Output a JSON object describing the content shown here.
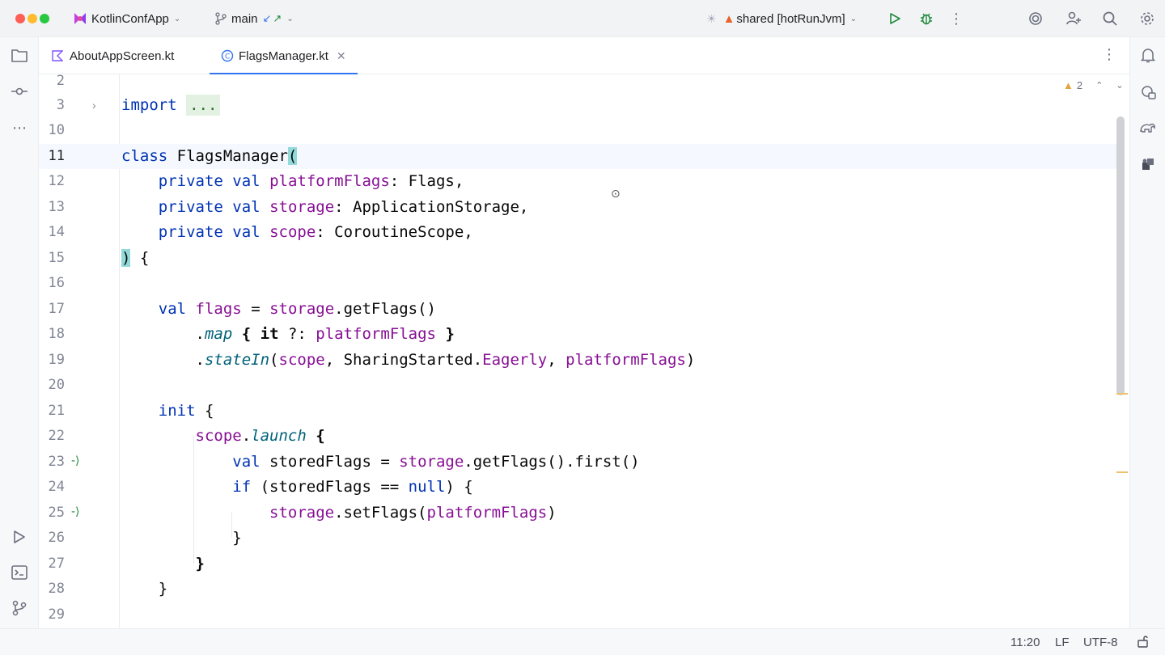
{
  "titlebar": {
    "project": "KotlinConfApp",
    "branch": "main",
    "run_config": "shared [hotRunJvm]"
  },
  "tabs": [
    {
      "label": "AboutAppScreen.kt",
      "active": false
    },
    {
      "label": "FlagsManager.kt",
      "active": true
    }
  ],
  "editor": {
    "warnings_count": "2",
    "lines": [
      {
        "num": "2"
      },
      {
        "num": "3"
      },
      {
        "num": "10"
      },
      {
        "num": "11"
      },
      {
        "num": "12"
      },
      {
        "num": "13"
      },
      {
        "num": "14"
      },
      {
        "num": "15"
      },
      {
        "num": "16"
      },
      {
        "num": "17"
      },
      {
        "num": "18"
      },
      {
        "num": "19"
      },
      {
        "num": "20"
      },
      {
        "num": "21"
      },
      {
        "num": "22"
      },
      {
        "num": "23"
      },
      {
        "num": "24"
      },
      {
        "num": "25"
      },
      {
        "num": "26"
      },
      {
        "num": "27"
      },
      {
        "num": "28"
      },
      {
        "num": "29"
      }
    ]
  },
  "code": {
    "l3_import": "import",
    "l3_fold": "...",
    "l11_class": "class",
    "l11_name": " FlagsManager",
    "l11_paren": "(",
    "private": "private",
    "val": "val",
    "l12_prop": "platformFlags",
    "l12_rest": ": Flags,",
    "l13_prop": "storage",
    "l13_rest": ": ApplicationStorage,",
    "l14_prop": "scope",
    "l14_rest": ": CoroutineScope,",
    "l15_paren": ")",
    "l15_rest": " {",
    "l17_prop": "flags",
    "l17_eq": " = ",
    "l17_storage": "storage",
    "l17_rest": ".getFlags()",
    "l18_dot": ".",
    "l18_map": "map",
    "l18_open": " { ",
    "l18_it": "it",
    "l18_elvis": " ?: ",
    "l18_pf": "platformFlags",
    "l18_close": " }",
    "l19_dot": ".",
    "l19_fn": "stateIn",
    "l19_open": "(",
    "l19_scope": "scope",
    "l19_mid": ", SharingStarted.",
    "l19_eager": "Eagerly",
    "l19_comma": ", ",
    "l19_pf": "platformFlags",
    "l19_close": ")",
    "l21_init": "init",
    "l21_rest": " {",
    "l22_scope": "scope",
    "l22_dot": ".",
    "l22_launch": "launch",
    "l22_rest": " {",
    "l23_val": "val",
    "l23_rest": " storedFlags = ",
    "l23_storage": "storage",
    "l23_tail": ".getFlags().first()",
    "l24_if": "if",
    "l24_mid": " (storedFlags == ",
    "l24_null": "null",
    "l24_rest": ") {",
    "l25_storage": "storage",
    "l25_mid": ".setFlags(",
    "l25_pf": "platformFlags",
    "l25_close": ")",
    "l26": "}",
    "l27": "}",
    "l28": "}"
  },
  "status": {
    "position": "11:20",
    "line_sep": "LF",
    "encoding": "UTF-8"
  }
}
